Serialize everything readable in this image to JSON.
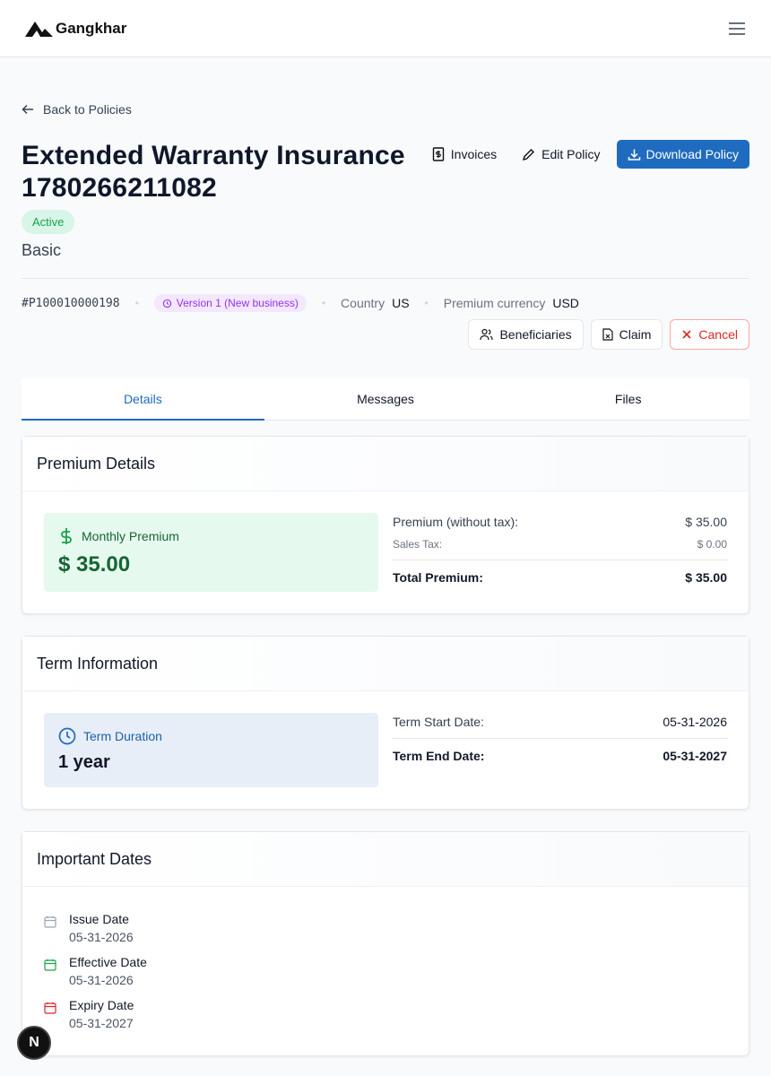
{
  "app": {
    "name": "Gangkhar"
  },
  "nav": {
    "back_label": "Back to Policies"
  },
  "policy": {
    "title": "Extended Warranty Insurance 1780266211082",
    "status": "Active",
    "plan": "Basic",
    "number": "#P100010000198",
    "version": "Version 1 (New business)",
    "country_label": "Country",
    "country": "US",
    "currency_label": "Premium currency",
    "currency": "USD"
  },
  "header_actions": {
    "invoices": "Invoices",
    "edit": "Edit Policy",
    "download": "Download Policy"
  },
  "secondary_actions": {
    "beneficiaries": "Beneficiaries",
    "claim": "Claim",
    "cancel": "Cancel"
  },
  "tabs": [
    {
      "label": "Details",
      "active": true
    },
    {
      "label": "Messages"
    },
    {
      "label": "Files"
    }
  ],
  "premium": {
    "title": "Premium Details",
    "monthly_label": "Monthly Premium",
    "monthly_value": "$ 35.00",
    "rows": {
      "without_tax_label": "Premium (without tax):",
      "without_tax": "$ 35.00",
      "sales_tax_label": "Sales Tax:",
      "sales_tax": "$ 0.00",
      "total_label": "Total Premium:",
      "total": "$ 35.00"
    }
  },
  "term": {
    "title": "Term Information",
    "duration_label": "Term Duration",
    "duration_value": "1 year",
    "start_label": "Term Start Date:",
    "start": "05-31-2026",
    "end_label": "Term End Date:",
    "end": "05-31-2027"
  },
  "dates": {
    "title": "Important Dates",
    "items": [
      {
        "label": "Issue Date",
        "value": "05-31-2026"
      },
      {
        "label": "Effective Date",
        "value": "05-31-2026"
      },
      {
        "label": "Expiry Date",
        "value": "05-31-2027"
      }
    ]
  },
  "dev": {
    "badge": "N"
  },
  "colors": {
    "primary": "#1f6bbf",
    "success": "#16a34a",
    "danger": "#dc2626",
    "version": "#9333ea"
  }
}
